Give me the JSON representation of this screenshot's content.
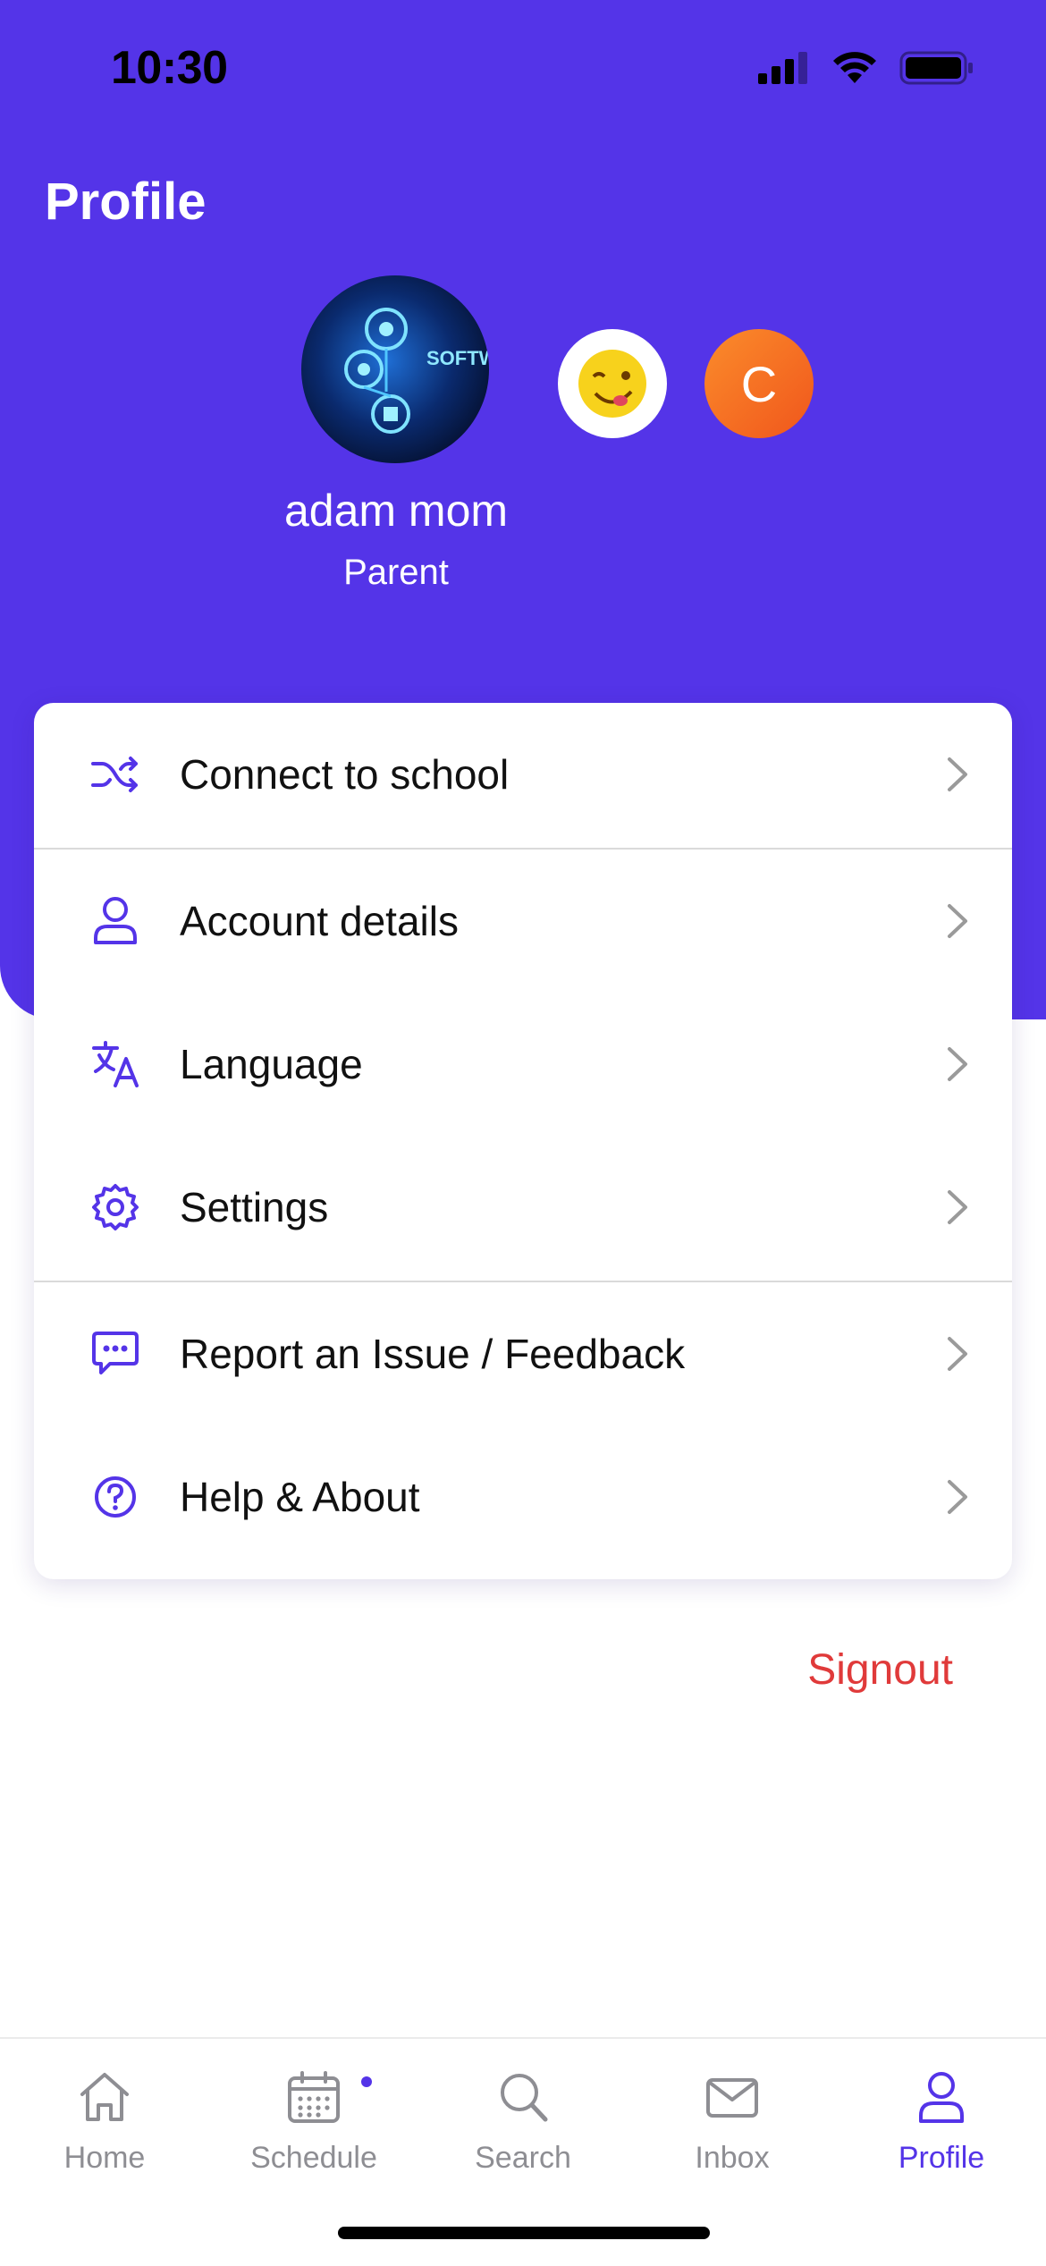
{
  "status_bar": {
    "time": "10:30"
  },
  "header": {
    "title": "Profile"
  },
  "profile": {
    "name": "adam mom",
    "role": "Parent",
    "avatar_image_text": "SOFTW TEST",
    "alt_avatar_letter": "C"
  },
  "menu": {
    "items": [
      {
        "label": "Connect to school",
        "icon": "shuffle-icon"
      },
      {
        "label": "Account details",
        "icon": "user-icon"
      },
      {
        "label": "Language",
        "icon": "translate-icon"
      },
      {
        "label": "Settings",
        "icon": "gear-icon"
      },
      {
        "label": "Report an Issue / Feedback",
        "icon": "message-icon"
      },
      {
        "label": "Help & About",
        "icon": "help-circle-icon"
      }
    ]
  },
  "signout": {
    "label": "Signout"
  },
  "tabbar": {
    "tabs": [
      {
        "label": "Home",
        "icon": "home-icon",
        "active": false
      },
      {
        "label": "Schedule",
        "icon": "calendar-icon",
        "active": false,
        "has_notification_dot": true
      },
      {
        "label": "Search",
        "icon": "search-icon",
        "active": false
      },
      {
        "label": "Inbox",
        "icon": "mail-icon",
        "active": false
      },
      {
        "label": "Profile",
        "icon": "user-icon",
        "active": true
      }
    ]
  },
  "colors": {
    "brand": "#5434e8",
    "danger": "#e03a3a",
    "inactive": "#8e8e93"
  }
}
